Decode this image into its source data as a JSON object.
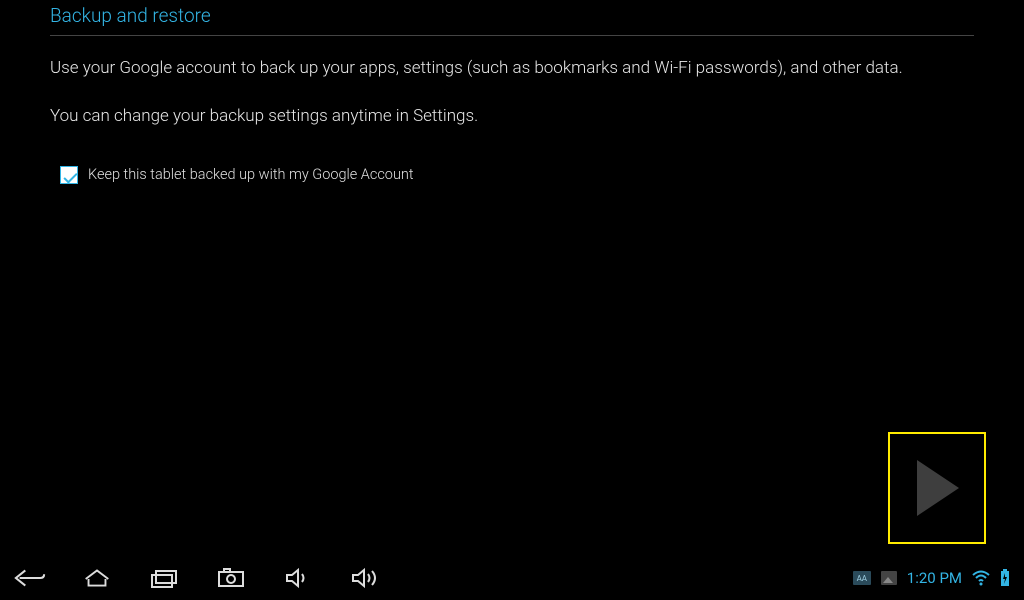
{
  "header": {
    "title": "Backup and restore"
  },
  "body": {
    "desc1": "Use your Google account to back up your apps, settings (such as bookmarks and Wi-Fi passwords), and other data.",
    "desc2": "You can change your backup settings anytime in Settings.",
    "checkbox_label": "Keep this tablet backed up with my Google Account",
    "checkbox_checked": true
  },
  "actions": {
    "next_label": "Next"
  },
  "statusbar": {
    "time": "1:20 PM",
    "aa": "AA"
  }
}
